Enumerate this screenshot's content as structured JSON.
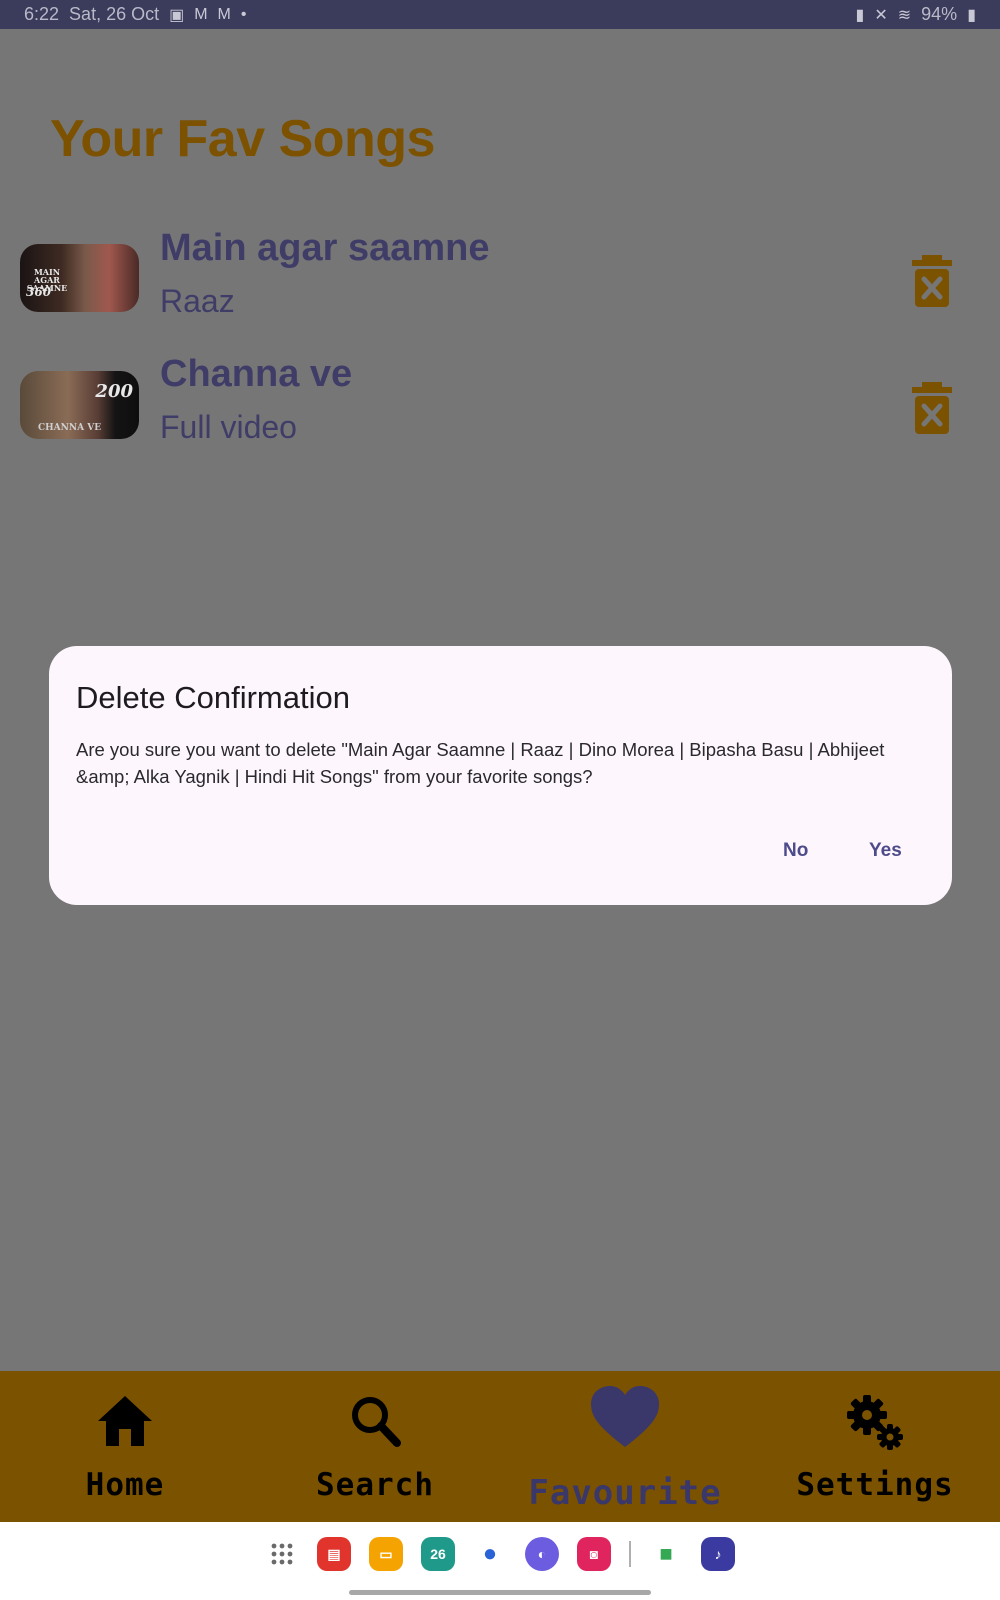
{
  "status_bar": {
    "time": "6:22",
    "date": "Sat, 26 Oct",
    "notification_icons": [
      "gallery-icon",
      "gmail-icon",
      "gmail-icon",
      "dot-icon"
    ],
    "system_icons": [
      "lock-icon",
      "mute-icon",
      "wifi-icon"
    ],
    "battery": "94%"
  },
  "page": {
    "title": "Your Fav Songs"
  },
  "songs": [
    {
      "title": "Main agar saamne",
      "subtitle": "Raaz",
      "thumb_text_top": "MAIN AGAR SAAMNE",
      "thumb_text_bottom": "360",
      "action_icon": "delete-icon"
    },
    {
      "title": "Channa ve",
      "subtitle": "Full video",
      "thumb_text_top": "200",
      "thumb_text_bottom": "CHANNA VE",
      "action_icon": "delete-icon"
    }
  ],
  "dialog": {
    "title": "Delete Confirmation",
    "message": "Are you sure you want to delete \"Main Agar Saamne | Raaz | Dino Morea | Bipasha Basu | Abhijeet &amp; Alka Yagnik | Hindi Hit Songs\" from your favorite songs?",
    "no_label": "No",
    "yes_label": "Yes"
  },
  "bottom_nav": {
    "items": [
      {
        "label": "Home",
        "icon": "home-icon"
      },
      {
        "label": "Search",
        "icon": "search-icon"
      },
      {
        "label": "Favourite",
        "icon": "heart-icon",
        "active": true
      },
      {
        "label": "Settings",
        "icon": "gears-icon"
      }
    ]
  },
  "taskbar": {
    "apps": [
      "app-drawer-icon",
      "notes-icon",
      "my-files-icon",
      "calendar-icon",
      "messages-icon",
      "internet-icon",
      "camera-icon",
      "meet-icon",
      "music-app-icon"
    ],
    "calendar_day": "26"
  },
  "colors": {
    "accent": "#7b5200",
    "title": "#7c5200",
    "text_primary": "#3f3d67",
    "dialog_bg": "#fdf7fd",
    "dim_overlay": "#767676"
  }
}
